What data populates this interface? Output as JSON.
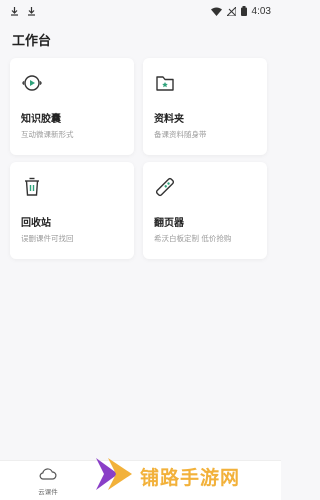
{
  "status_bar": {
    "time": "4:03"
  },
  "page": {
    "title": "工作台"
  },
  "cards": [
    {
      "title": "知识胶囊",
      "subtitle": "互动微课新形式",
      "icon": "capsule-play-icon"
    },
    {
      "title": "资料夹",
      "subtitle": "备课资料随身带",
      "icon": "folder-icon"
    },
    {
      "title": "回收站",
      "subtitle": "误删课件可找回",
      "icon": "trash-icon"
    },
    {
      "title": "翻页器",
      "subtitle": "希沃白板定制 低价抢购",
      "icon": "pen-remote-icon"
    }
  ],
  "bottom_nav": {
    "cloud_label": "云课件"
  },
  "watermark": {
    "text": "铺路手游网"
  },
  "colors": {
    "accent": "#2fa27b",
    "watermark_orange": "#f2b13a",
    "watermark_purple": "#8a3fc7"
  }
}
